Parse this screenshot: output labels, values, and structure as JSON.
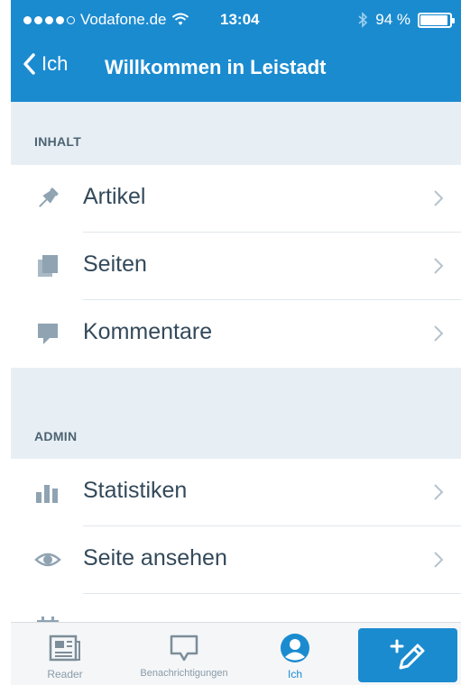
{
  "status_bar": {
    "carrier": "Vodafone.de",
    "time": "13:04",
    "battery": "94 %",
    "battery_level": 0.94
  },
  "nav": {
    "back_label": "Ich",
    "title": "Willkommen in Leistadt"
  },
  "sections": {
    "content": {
      "label": "INHALT",
      "items": [
        {
          "label": "Artikel",
          "icon": "pin-icon"
        },
        {
          "label": "Seiten",
          "icon": "pages-icon"
        },
        {
          "label": "Kommentare",
          "icon": "comment-icon"
        }
      ]
    },
    "admin": {
      "label": "ADMIN",
      "items": [
        {
          "label": "Statistiken",
          "icon": "stats-icon"
        },
        {
          "label": "Seite ansehen",
          "icon": "eye-icon"
        }
      ]
    }
  },
  "tabbar": {
    "tabs": [
      {
        "label": "Reader",
        "icon": "reader-icon"
      },
      {
        "label": "Benachrichtigungen",
        "icon": "notifications-icon"
      },
      {
        "label": "Ich",
        "icon": "me-icon"
      }
    ],
    "new_post_icon": "new-post-icon"
  },
  "colors": {
    "accent": "#1b8bd0",
    "section_bg": "#e8eff4",
    "text": "#33495a",
    "icon": "#8fa3b2"
  }
}
